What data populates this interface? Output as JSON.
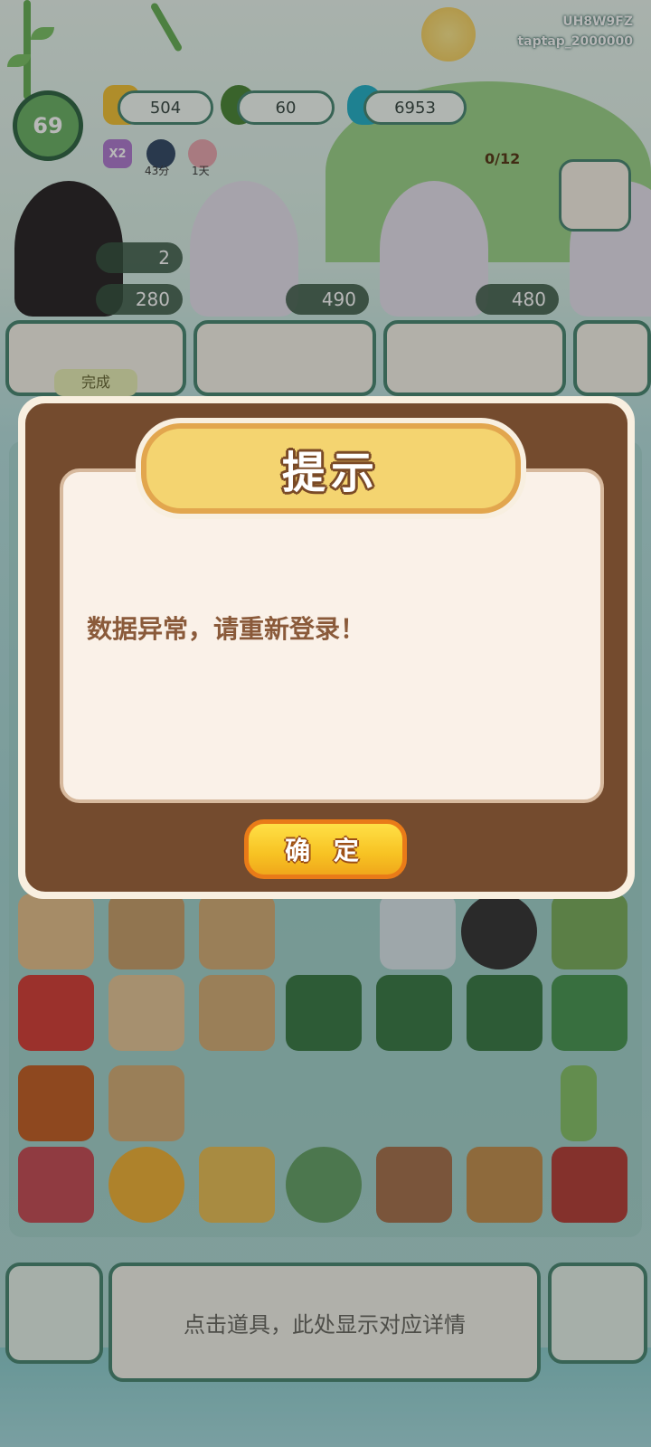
{
  "watermark": {
    "user_code": "UH8W9FZ",
    "account": "taptap_2000000"
  },
  "hud": {
    "level": "69",
    "resources": {
      "coins": "504",
      "jade": "60",
      "energy": "6953"
    },
    "boosts": [
      {
        "label": "X2",
        "note": ""
      },
      {
        "label": "",
        "note": "43分"
      },
      {
        "label": "",
        "note": "1天"
      }
    ]
  },
  "customers": [
    {
      "count": "2",
      "energy": "280"
    },
    {
      "count": "",
      "energy": "490"
    },
    {
      "count": "0/12",
      "energy": "480"
    }
  ],
  "order": {
    "done_label": "完成"
  },
  "dialog": {
    "title": "提示",
    "message": "数据异常，请重新登录！",
    "confirm_label": "确 定"
  },
  "bottom": {
    "hint": "点击道具，此处显示对应详情"
  },
  "colors": {
    "dialog_frame": "#744b2e",
    "title_plate": "#f4d470",
    "button": "#f7c223",
    "accent": "#4e8b77"
  }
}
